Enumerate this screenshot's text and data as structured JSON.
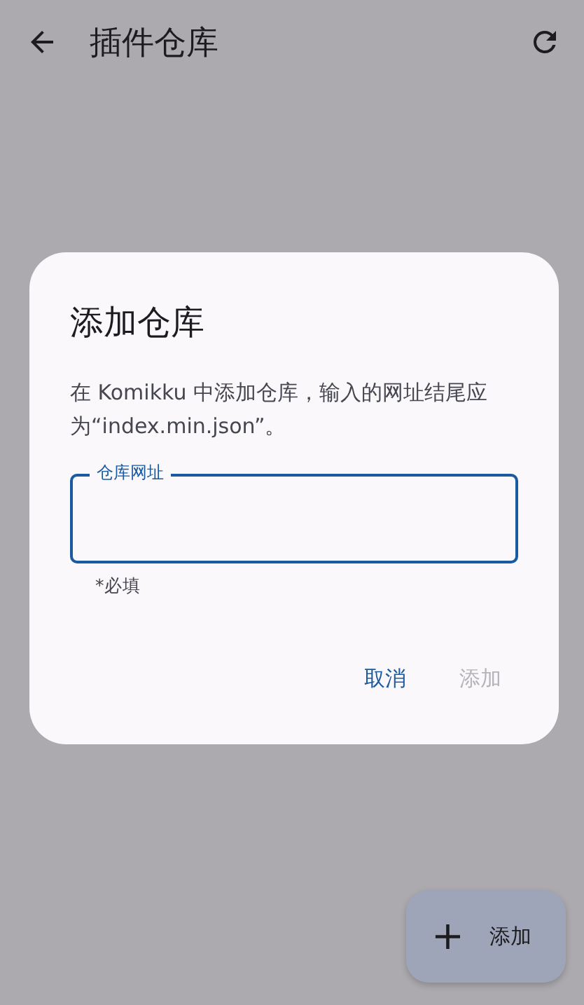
{
  "app_bar": {
    "title": "插件仓库"
  },
  "dialog": {
    "title": "添加仓库",
    "message": "在 Komikku 中添加仓库，输入的网址结尾应为“index.min.json”。",
    "field": {
      "label": "仓库网址",
      "focused": true,
      "helper": "*必填"
    },
    "buttons": [
      {
        "label": "取消",
        "disabled": false
      },
      {
        "label": "添加",
        "disabled": true
      }
    ]
  },
  "fab": {
    "icon": "+",
    "label": "添加"
  }
}
